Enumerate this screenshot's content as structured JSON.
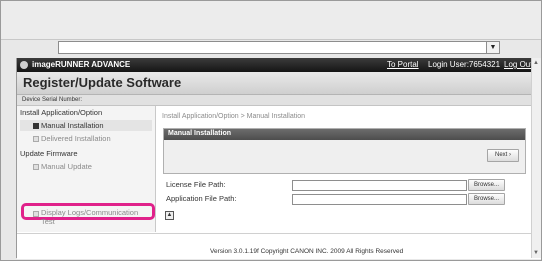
{
  "window": {
    "address_dropdown_icon": "chevron-down-icon"
  },
  "titlebar": {
    "brand": "imageRUNNER ADVANCE",
    "to_portal": "To Portal",
    "login_user": "Login User:7654321",
    "log_out": "Log Out"
  },
  "page": {
    "title": "Register/Update Software",
    "serial_label": "Device Serial Number:"
  },
  "sidebar": {
    "section1": "Install Application/Option",
    "item1": "Manual Installation",
    "item2": "Delivered Installation",
    "section2": "Update Firmware",
    "item3": "Manual Update",
    "item4": "Display Logs/Communication Test"
  },
  "main": {
    "breadcrumb": "Install Application/Option > Manual Installation",
    "section_title": "Manual Installation",
    "next_label": "Next",
    "license_label": "License File Path:",
    "application_label": "Application File Path:",
    "browse_label": "Browse..."
  },
  "footer": {
    "copyright": "Version 3.0.1.19f Copyright CANON INC. 2009 All Rights Reserved"
  },
  "colors": {
    "highlight": "#e0218a",
    "titlebar": "#1f1f1f"
  }
}
